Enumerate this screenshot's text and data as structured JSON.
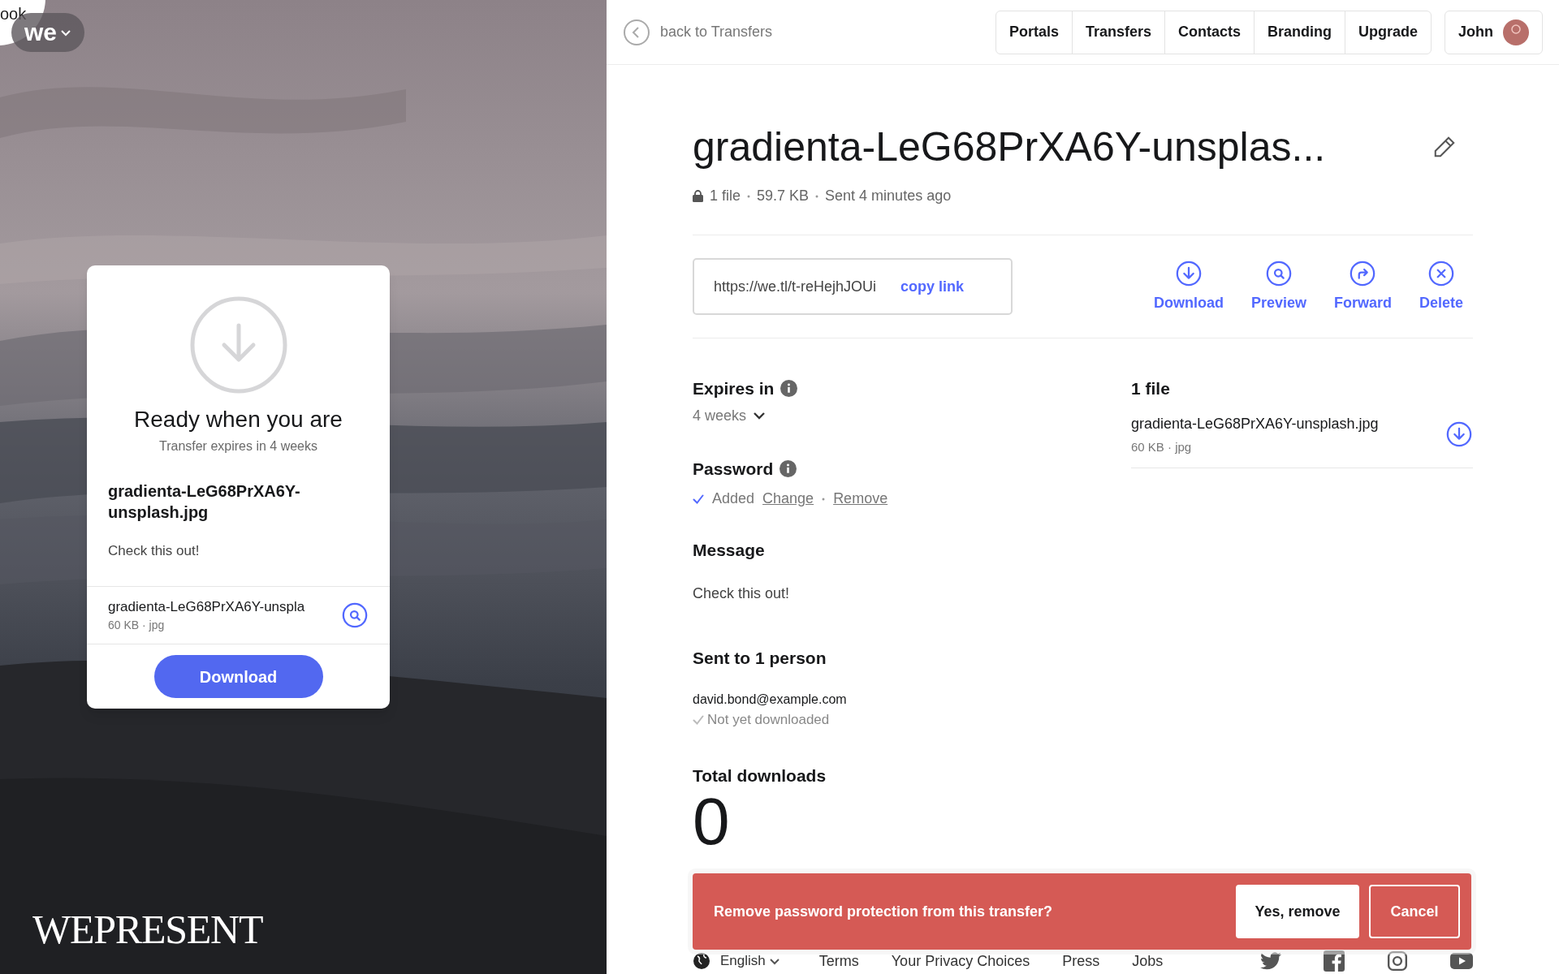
{
  "left_panel": {
    "corner_text": "ook",
    "logo": "we",
    "brand": "WEPRESENT",
    "card": {
      "title": "Ready when you are",
      "subtitle": "Transfer expires in 4 weeks",
      "file_title": "gradienta-LeG68PrXA6Y-unsplash.jpg",
      "message": "Check this out!",
      "file": {
        "name": "gradienta-LeG68PrXA6Y-unspla",
        "meta": "60 KB · jpg"
      },
      "button": "Download"
    }
  },
  "header": {
    "back_link": "back to Transfers",
    "nav": [
      "Portals",
      "Transfers",
      "Contacts",
      "Branding",
      "Upgrade"
    ],
    "user": {
      "name": "John"
    }
  },
  "transfer": {
    "title": "gradienta-LeG68PrXA6Y-unsplas...",
    "meta": [
      "1 file",
      "59.7 KB",
      "Sent 4 minutes ago"
    ],
    "link": "https://we.tl/t-reHejhJOUi",
    "copy_link": "copy link",
    "actions": [
      {
        "kind": "download",
        "label": "Download"
      },
      {
        "kind": "preview",
        "label": "Preview"
      },
      {
        "kind": "forward",
        "label": "Forward"
      },
      {
        "kind": "delete",
        "label": "Delete"
      }
    ]
  },
  "details": {
    "expires": {
      "label": "Expires in",
      "value": "4 weeks"
    },
    "password": {
      "label": "Password",
      "added": true,
      "status": "Added",
      "links": [
        "Change",
        "Remove"
      ]
    },
    "message": {
      "label": "Message",
      "text": "Check this out!"
    },
    "recipients": {
      "label": "Sent to 1 person",
      "items": [
        {
          "email": "david.bond@example.com",
          "status": "Not yet downloaded",
          "downloaded": false
        }
      ]
    },
    "total": {
      "label": "Total downloads",
      "value": "0"
    }
  },
  "files": {
    "label": "1 file",
    "items": [
      {
        "name": "gradienta-LeG68PrXA6Y-unsplash.jpg",
        "meta": "60 KB · jpg"
      }
    ]
  },
  "banner": {
    "text": "Remove password protection from this transfer?",
    "confirm": "Yes, remove",
    "cancel": "Cancel"
  },
  "footer": {
    "language": "English",
    "links": [
      "Terms",
      "Your Privacy Choices",
      "Press",
      "Jobs"
    ],
    "socials": [
      {
        "kind": "twitter"
      },
      {
        "kind": "facebook"
      },
      {
        "kind": "instagram"
      },
      {
        "kind": "youtube"
      }
    ]
  }
}
